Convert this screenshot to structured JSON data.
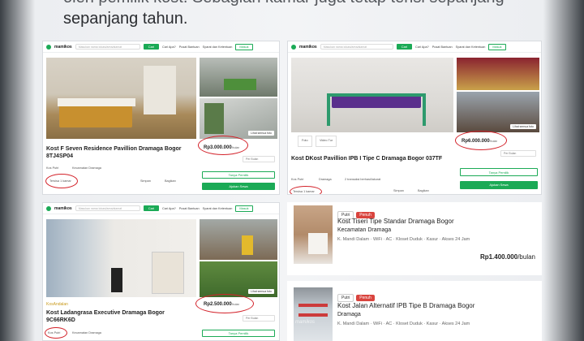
{
  "slide": {
    "intro_line1": "oleh pemilik kost. Sebagian kamar juga tetap terisi sepanjang",
    "intro_line2": "sepanjang tahun."
  },
  "site": {
    "logo": "mamikos",
    "search_placeholder": "Masukan nama lokasi/area/alamat",
    "search_button": "Cari",
    "nav_links": [
      "Cari Apa?",
      "Pusat Bantuan",
      "Syarat dan Ketentuan"
    ],
    "login": "Masuk",
    "see_photos": "Lihat semua foto"
  },
  "cards": [
    {
      "title": "Kost F Seven Residence Pavillion Dramaga Bogor 8TJ4SP04",
      "type": "Kos Putri",
      "location": "Kecamatan Dramaga",
      "status": "Tersisa 1 kamar",
      "price": "Rp3.000.000",
      "per": "/bulan",
      "save": "Simpan",
      "share": "Bagikan",
      "duration": "Per Bulan",
      "btn_out": "Tanya Pemilik",
      "btn_fill": "Ajukan Sewa"
    },
    {
      "title": "Kost DKost Pavillion IPB I Tipe C Dramaga Bogor 037TF",
      "type": "Kos Putri",
      "location": "Dramaga",
      "extra": "2 transaksi berhasil/akurat",
      "status": "Tersisa 1 kamar",
      "price": "Rp6.000.000",
      "per": "/bulan",
      "tabs": [
        "Foto",
        "Video Tur"
      ],
      "save": "Simpan",
      "share": "Bagikan",
      "duration": "Per Bulan",
      "btn_out": "Tanya Pemilik",
      "btn_fill": "Ajukan Sewa"
    },
    {
      "title": "Kost Ladangrasa Executive Dramaga Bogor 9C66RK6D",
      "brand": "KosAndalan",
      "type": "Kos Putri",
      "location": "Kecamatan Dramaga",
      "price": "Rp2.500.000",
      "per": "/bulan",
      "duration": "Per Bulan",
      "btn_out": "Tanya Pemilik"
    }
  ],
  "listings": [
    {
      "tags": [
        "Putri",
        "Penuh"
      ],
      "title": "Kost Tiseri Tipe Standar Dramaga Bogor",
      "area": "Kecamatan Dramaga",
      "facilities": "K. Mandi Dalam · WiFi · AC · Kloset Duduk · Kasur · Akses 24 Jam",
      "price": "Rp1.400.000",
      "per": "/bulan"
    },
    {
      "tags": [
        "Putri",
        "Penuh"
      ],
      "title": "Kost Jalan Alternatif IPB Tipe B Dramaga Bogor",
      "area": "Dramaga",
      "facilities": "K. Mandi Dalam · WiFi · AC · Kloset Duduk · Kasur · Akses 24 Jam",
      "watermark": "mamikos"
    }
  ],
  "colors": {
    "brand_green": "#1baa56",
    "highlight_red": "#d3222a",
    "full_badge": "#d9443e"
  }
}
